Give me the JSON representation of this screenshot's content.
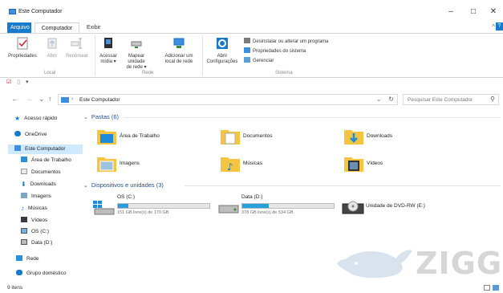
{
  "window": {
    "title": "Este Computador",
    "minimize": "–",
    "maximize": "□",
    "close": "✕"
  },
  "ribbon_tabs": {
    "file": "Arquivo",
    "computer": "Computador",
    "view": "Exibir",
    "collapse": "^",
    "help": "?"
  },
  "ribbon": {
    "properties": "Propriedades",
    "open": "Abrir",
    "rename": "Renomear",
    "access_media": [
      "Acessar",
      "mídia ▾"
    ],
    "map_drive": [
      "Mapear unidade",
      "de rede ▾"
    ],
    "add_location": [
      "Adicionar um",
      "local de rede"
    ],
    "open_settings": [
      "Abrir",
      "Configurações"
    ],
    "uninstall": "Desinstalar ou alterar um programa",
    "system_props": "Propriedades do sistema",
    "manage": "Gerenciar",
    "group_local": "Local",
    "group_network": "Rede",
    "group_system": "Sistema"
  },
  "quick_access_toolbar": [
    "☑",
    "▯",
    "▾"
  ],
  "navbar": {
    "back": "←",
    "forward": "→",
    "recent": "⌄",
    "up": "↑",
    "path": "Este Computador",
    "path_sep": "›",
    "dropdown": "⌄",
    "refresh": "↻",
    "search_placeholder": "Pesquisar Este Computador",
    "search_icon": "⚲"
  },
  "nav_pane": [
    {
      "label": "Acesso rápido",
      "icon": "star-icon"
    },
    {
      "label": "OneDrive",
      "icon": "cloud-icon"
    },
    {
      "label": "Este Computador",
      "icon": "computer-icon"
    },
    {
      "label": "Área de Trabalho",
      "icon": "desktop-icon"
    },
    {
      "label": "Documentos",
      "icon": "document-icon"
    },
    {
      "label": "Downloads",
      "icon": "download-icon"
    },
    {
      "label": "Imagens",
      "icon": "image-icon"
    },
    {
      "label": "Músicas",
      "icon": "music-icon"
    },
    {
      "label": "Vídeos",
      "icon": "video-icon"
    },
    {
      "label": "OS (C:)",
      "icon": "drive-icon"
    },
    {
      "label": "Data (D:)",
      "icon": "drive-icon"
    },
    {
      "label": "Rede",
      "icon": "network-icon"
    },
    {
      "label": "Grupo doméstico",
      "icon": "homegroup-icon"
    }
  ],
  "folders_header": "Pastas (6)",
  "folders": [
    {
      "label": "Área de Trabalho",
      "icon": "desktop-folder-icon"
    },
    {
      "label": "Documentos",
      "icon": "documents-folder-icon"
    },
    {
      "label": "Downloads",
      "icon": "downloads-folder-icon"
    },
    {
      "label": "Imagens",
      "icon": "pictures-folder-icon"
    },
    {
      "label": "Músicas",
      "icon": "music-folder-icon"
    },
    {
      "label": "Vídeos",
      "icon": "videos-folder-icon"
    }
  ],
  "drives_header": "Dispositivos e unidades (3)",
  "drives": [
    {
      "name": "OS (C:)",
      "free": "151 GB livre(s) de 170 GB",
      "used_fraction": 0.11
    },
    {
      "name": "Data (D:)",
      "free": "378 GB livre(s) de 534 GB",
      "used_fraction": 0.29
    },
    {
      "name": "Unidade de DVD-RW (E:)"
    }
  ],
  "status": {
    "count": "9 itens"
  },
  "watermark": "ZIGG",
  "colors": {
    "accent": "#1979ca",
    "selection": "#cde8ff",
    "bar_fill": "#26a0da",
    "header_text": "#1e4e8c"
  }
}
